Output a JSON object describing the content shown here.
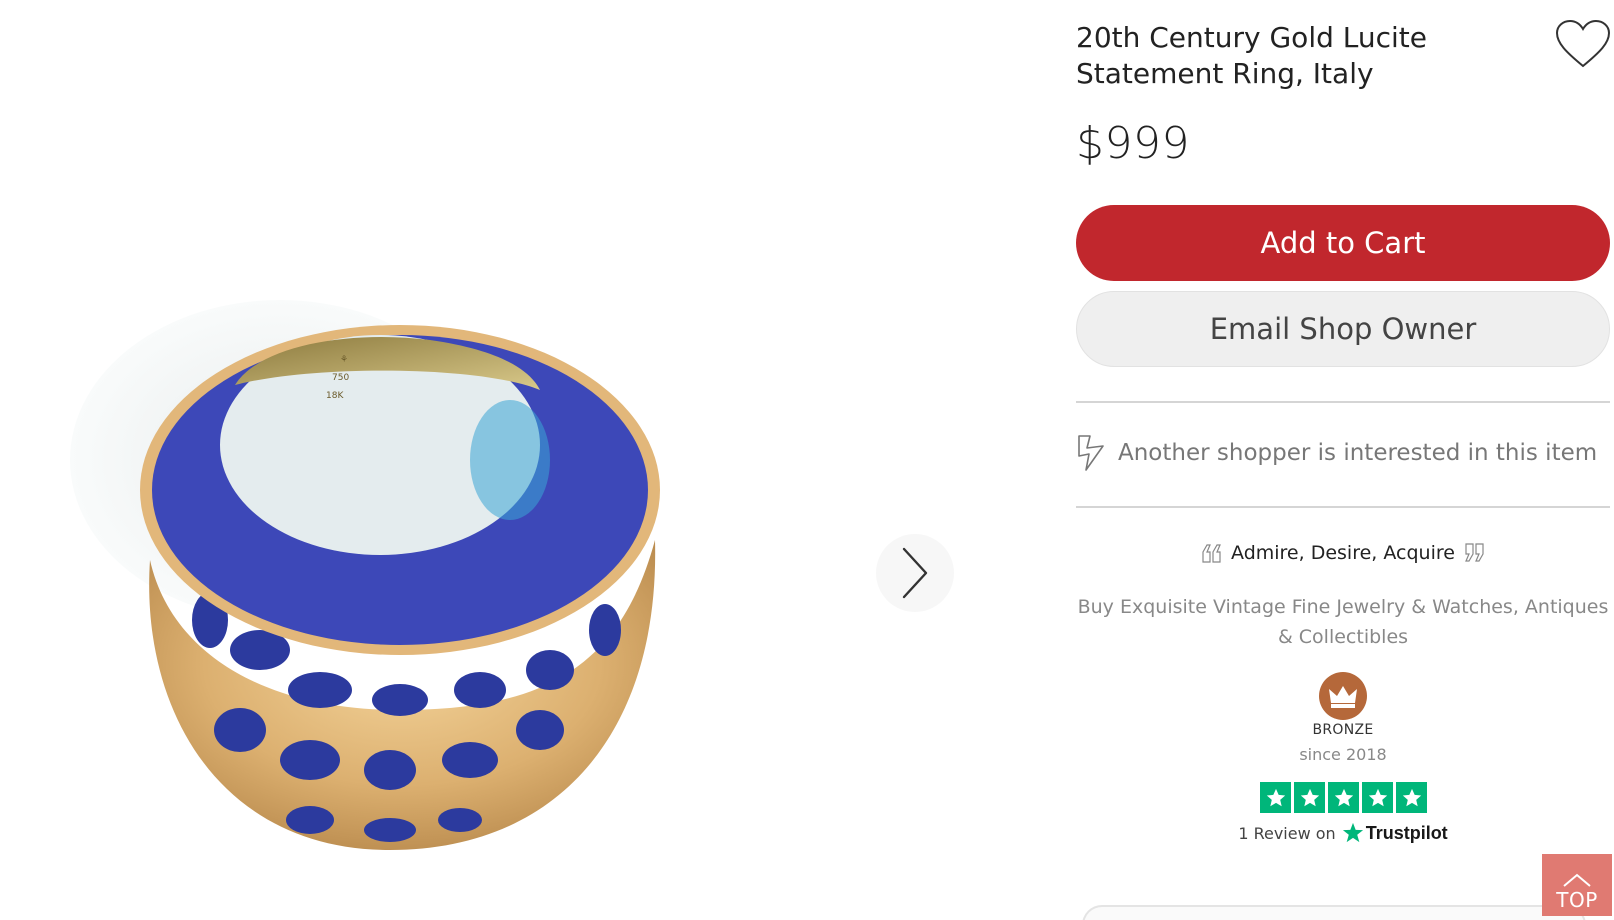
{
  "product": {
    "title": "20th Century Gold Lucite Statement Ring, Italy",
    "price": "$999",
    "image_description_icon": "ring-photo"
  },
  "actions": {
    "add_to_cart": "Add to Cart",
    "email_owner": "Email Shop Owner"
  },
  "interest": {
    "icon": "lightning-icon",
    "text": "Another shopper is interested in this item"
  },
  "shop": {
    "tagline": "Admire, Desire, Acquire",
    "description": "Buy Exquisite Vintage Fine Jewelry & Watches, Antiques & Collectibles",
    "tier": "BRONZE",
    "since": "since 2018"
  },
  "trustpilot": {
    "stars": 5,
    "review_prefix": "1 Review on",
    "brand": "Trustpilot"
  },
  "navigation": {
    "top_label": "TOP"
  },
  "colors": {
    "accent_red": "#c1272d",
    "trustpilot_green": "#00b67a",
    "bronze": "#b5683a",
    "top_button": "#e07a72"
  }
}
